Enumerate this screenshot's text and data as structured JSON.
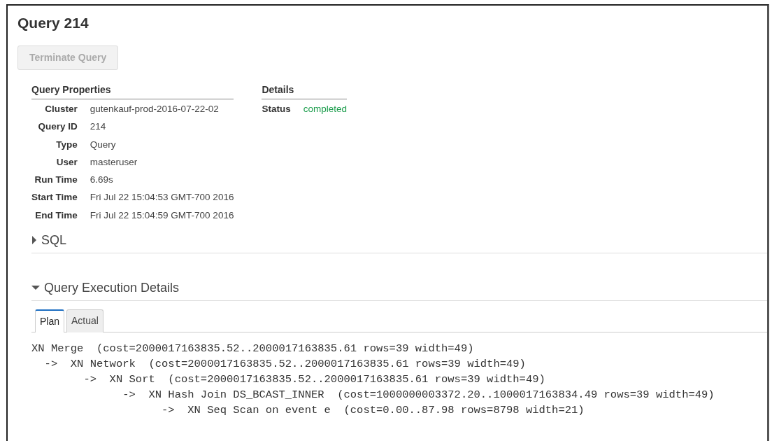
{
  "title": "Query 214",
  "buttons": [
    {
      "label": "Terminate Query",
      "disabled": true
    }
  ],
  "properties": {
    "heading": "Query Properties",
    "rows": [
      {
        "label": "Cluster",
        "value": "gutenkauf-prod-2016-07-22-02"
      },
      {
        "label": "Query ID",
        "value": "214"
      },
      {
        "label": "Type",
        "value": "Query"
      },
      {
        "label": "User",
        "value": "masteruser"
      },
      {
        "label": "Run Time",
        "value": "6.69s"
      },
      {
        "label": "Start Time",
        "value": "Fri Jul 22 15:04:53 GMT-700 2016"
      },
      {
        "label": "End Time",
        "value": "Fri Jul 22 15:04:59 GMT-700 2016"
      }
    ]
  },
  "details": {
    "heading": "Details",
    "rows": [
      {
        "label": "Status",
        "value": "completed",
        "color": "#1a9c4b"
      }
    ]
  },
  "sections": [
    {
      "title": "SQL",
      "expanded": false
    },
    {
      "title": "Query Execution Details",
      "expanded": true,
      "tabs": [
        {
          "label": "Plan",
          "selected": true
        },
        {
          "label": "Actual",
          "selected": false
        }
      ],
      "plan": [
        {
          "text": "XN Merge  (cost=2000017163835.52..2000017163835.61 rows=39 width=49)",
          "children": [
            {
              "text": "->  XN Network  (cost=2000017163835.52..2000017163835.61 rows=39 width=49)",
              "children": [
                {
                  "text": "->  XN Sort  (cost=2000017163835.52..2000017163835.61 rows=39 width=49)",
                  "children": [
                    {
                      "text": "->  XN Hash Join DS_BCAST_INNER  (cost=1000000003372.20..1000017163834.49 rows=39 width=49)",
                      "children": [
                        {
                          "text": "->  XN Seq Scan on event e  (cost=0.00..87.98 rows=8798 width=21)"
                        }
                      ]
                    }
                  ]
                }
              ]
            }
          ]
        }
      ]
    }
  ]
}
